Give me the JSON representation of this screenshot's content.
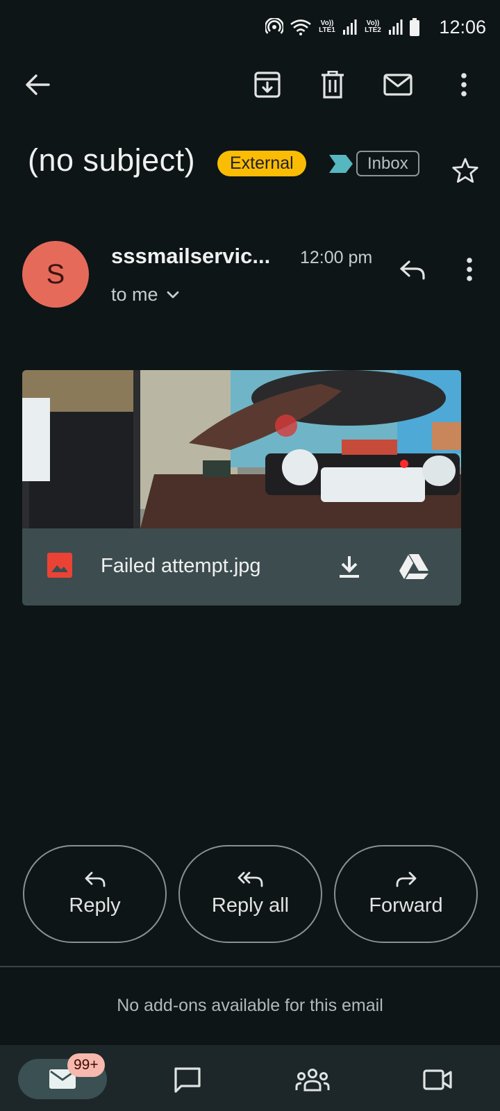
{
  "status_bar": {
    "time": "12:06",
    "sim1_label": "Vo)) LTE1",
    "sim2_label": "Vo)) LTE2",
    "icons": [
      "hotspot-icon",
      "wifi-icon",
      "signal-icon",
      "signal-icon",
      "battery-icon"
    ]
  },
  "toolbar": {
    "icons": [
      "back-arrow-icon",
      "archive-icon",
      "delete-icon",
      "mark-unread-icon",
      "more-vert-icon"
    ]
  },
  "email": {
    "subject": "(no subject)",
    "external_label": "External",
    "label": "Inbox",
    "sender_initial": "S",
    "sender_name": "sssmailservic...",
    "time": "12:00 pm",
    "recipient": "to me"
  },
  "attachment": {
    "file_name": "Failed attempt.jpg",
    "icons": [
      "image-file-icon",
      "download-icon",
      "drive-icon"
    ]
  },
  "actions": {
    "reply": "Reply",
    "reply_all": "Reply all",
    "forward": "Forward"
  },
  "addons_note": "No add-ons available for this email",
  "bottom_nav": {
    "mail_badge": "99+",
    "items": [
      "mail-icon",
      "chat-icon",
      "spaces-icon",
      "meet-icon"
    ]
  },
  "colors": {
    "background": "#0d1517",
    "avatar": "#e66a5a",
    "external_badge": "#fbbc04",
    "attachment_bar": "#3d4d4f",
    "nav_bar": "#1d2729"
  }
}
